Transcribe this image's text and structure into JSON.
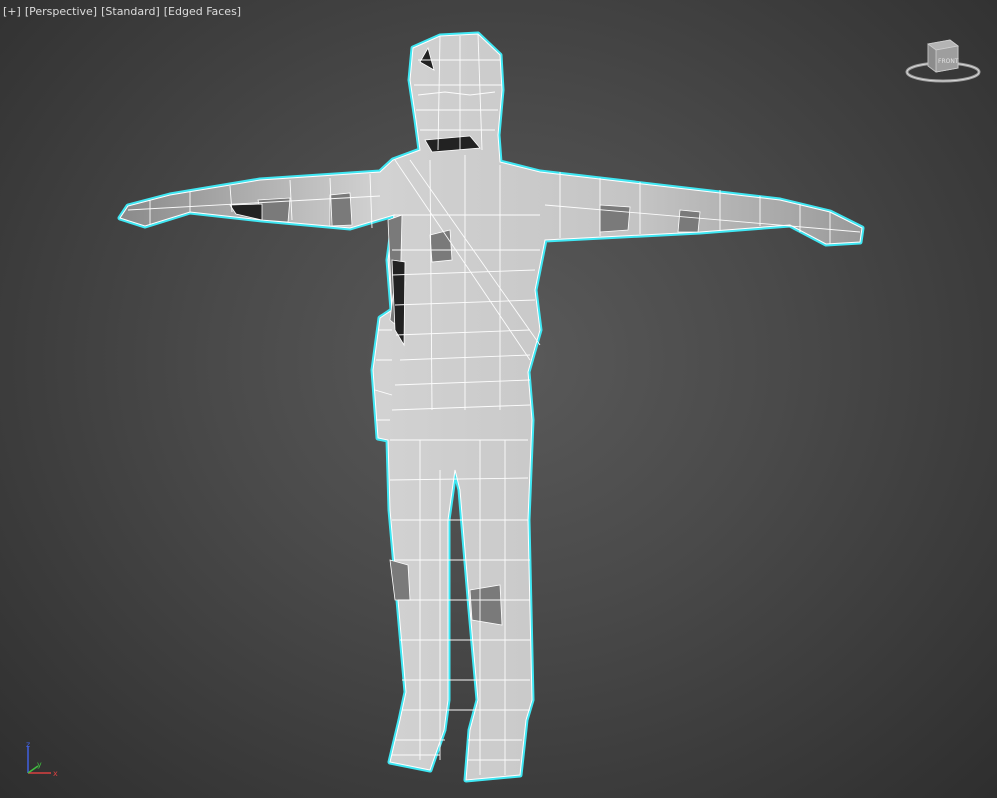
{
  "viewport": {
    "labels": {
      "maximize": "[+]",
      "view": "[Perspective]",
      "shading_mode": "[Standard]",
      "display_mode": "[Edged Faces]"
    },
    "viewcube_face": "FRONT",
    "axes": {
      "x": "x",
      "y": "y",
      "z": "z"
    }
  },
  "colors": {
    "background": "#3e3e3e",
    "mesh_fill": "#c8c8c8",
    "mesh_edges": "#ffffff",
    "selection_outline": "#3fe6f2",
    "axis_x": "#d94040",
    "axis_y": "#40c040",
    "axis_z": "#4060e0"
  },
  "icons": [
    "viewcube-icon",
    "axis-tripod-icon"
  ]
}
